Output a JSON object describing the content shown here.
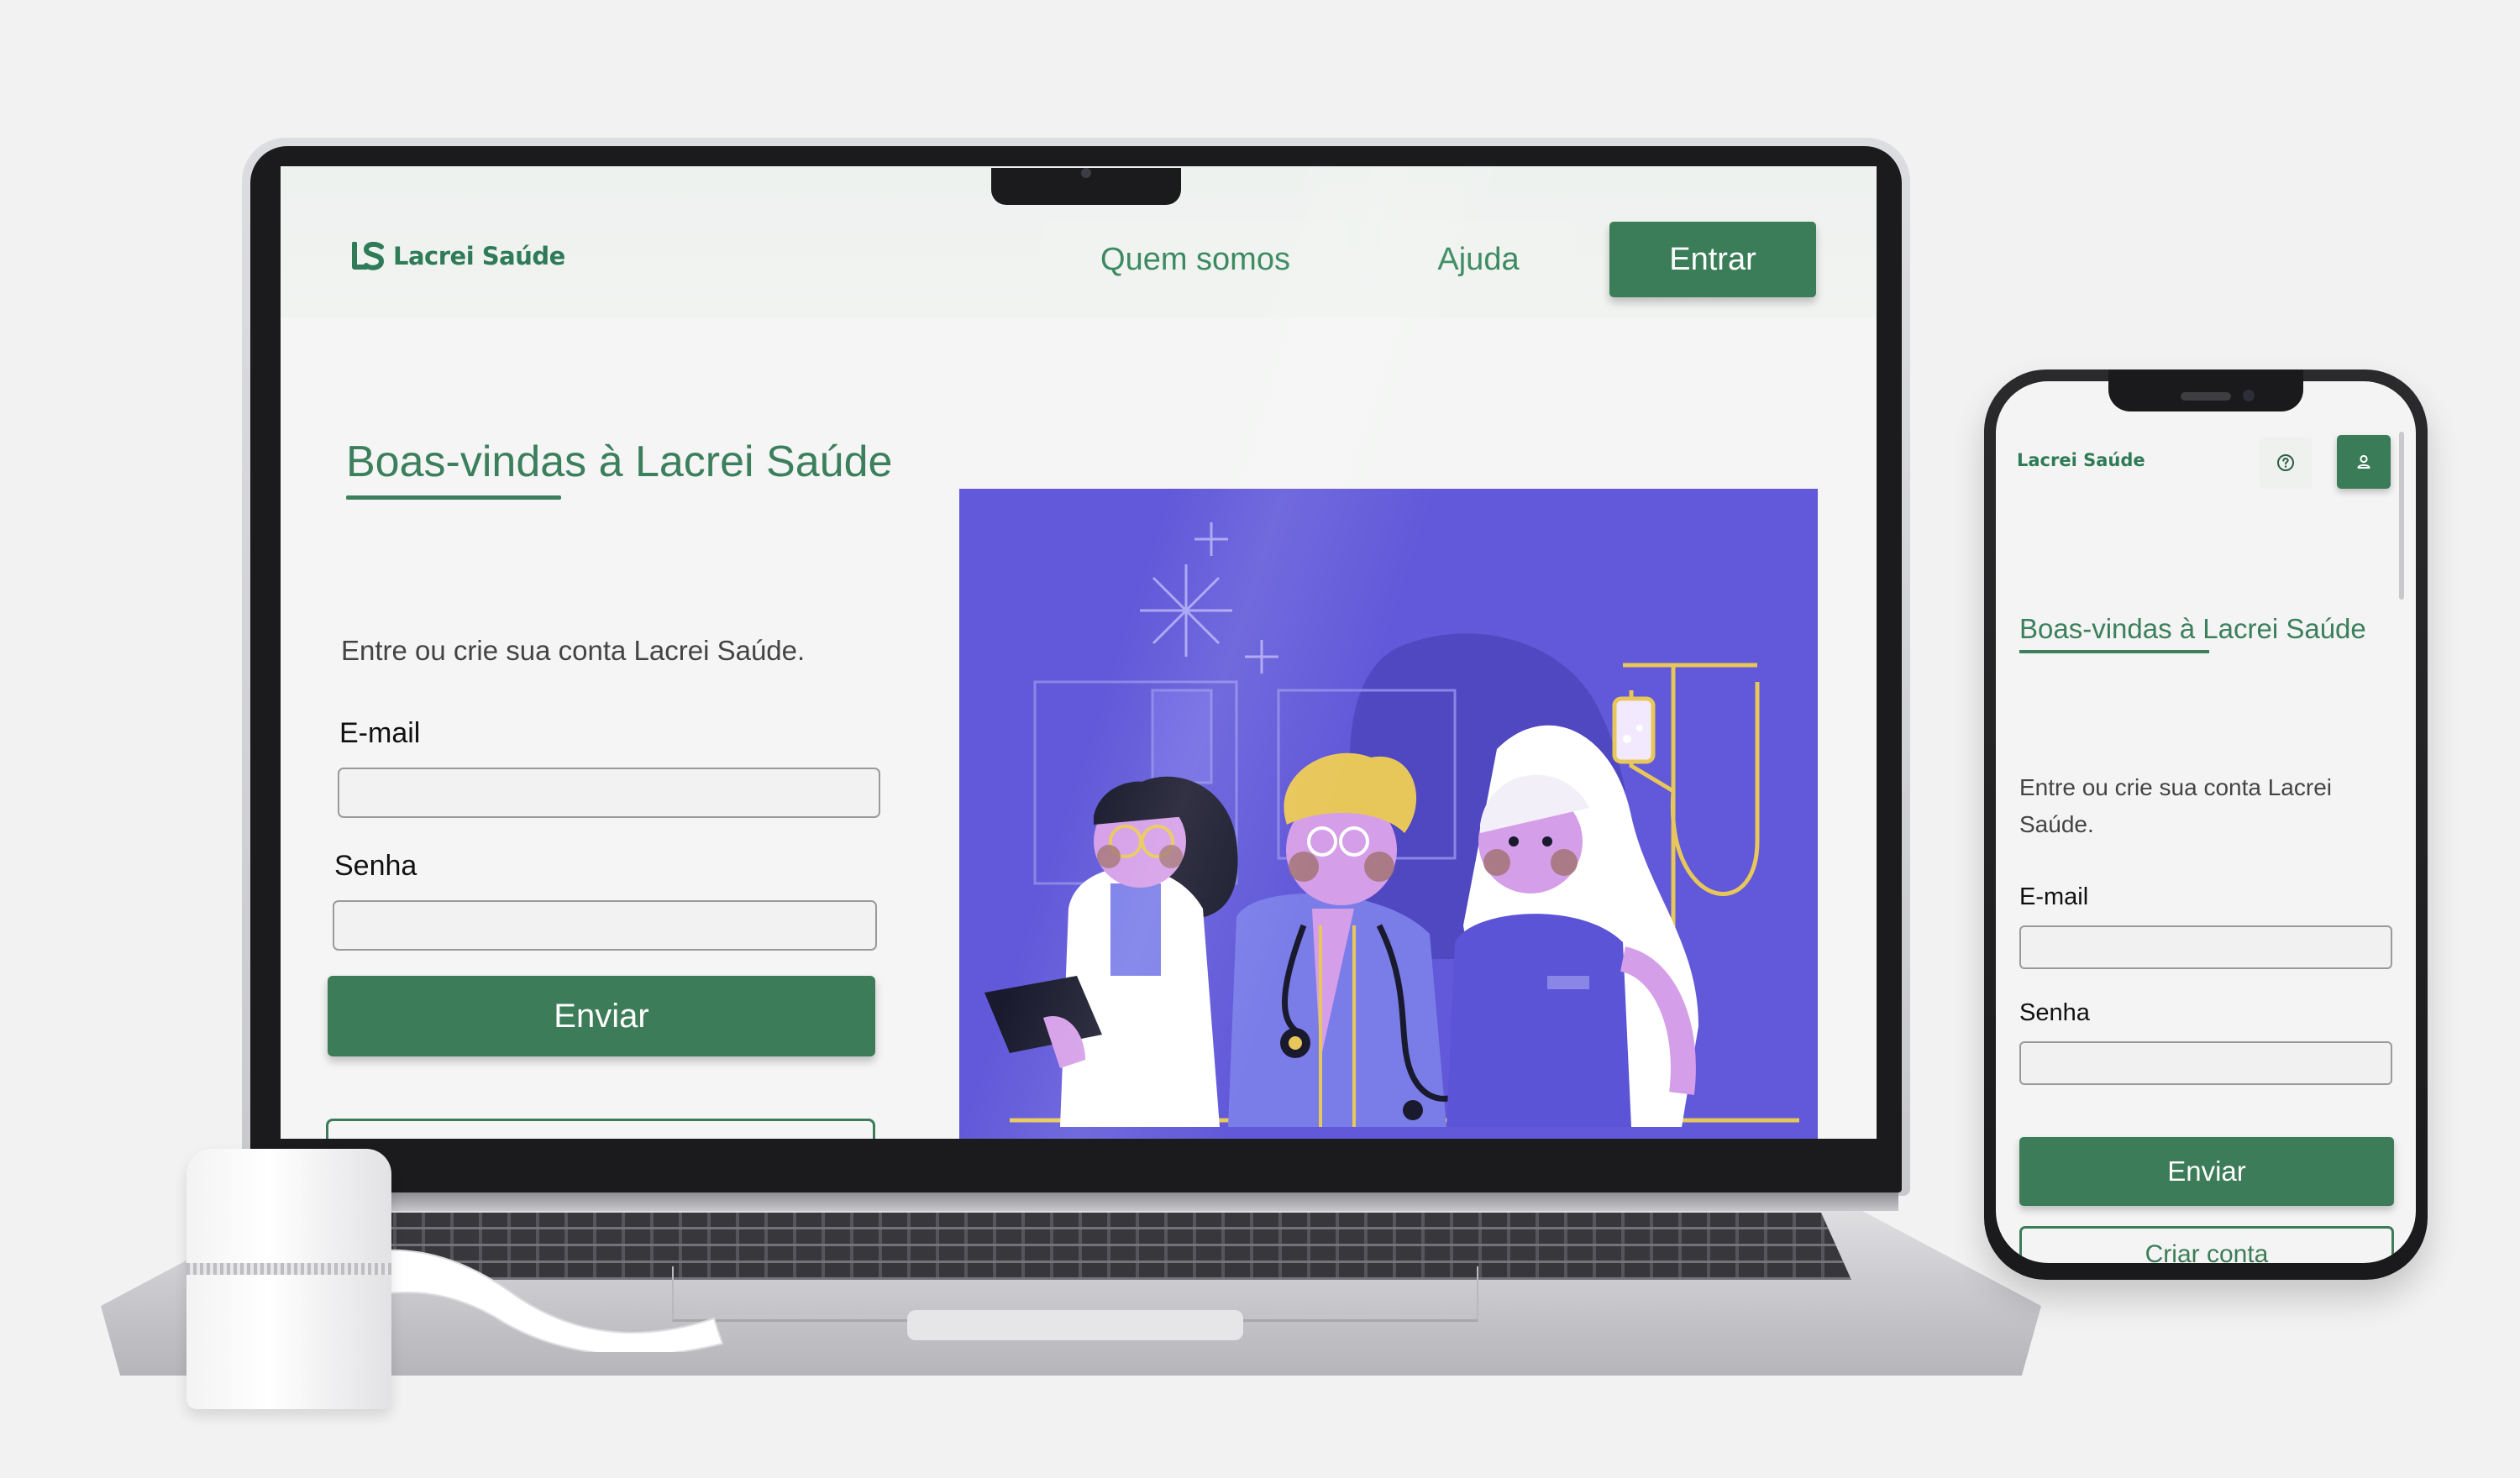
{
  "desktop": {
    "logo_text": "Lacrei Saúde",
    "nav": {
      "about_label": "Quem somos",
      "help_label": "Ajuda",
      "login_label": "Entrar"
    },
    "title": "Boas-vindas à Lacrei Saúde",
    "intro": "Entre ou crie sua conta Lacrei Saúde.",
    "email_label": "E-mail",
    "password_label": "Senha",
    "submit_label": "Enviar"
  },
  "mobile": {
    "logo_text": "Lacrei Saúde",
    "help_icon": "question-circle-icon",
    "user_icon": "user-icon",
    "title": "Boas-vindas à Lacrei Saúde",
    "intro": "Entre ou crie sua conta Lacrei Saúde.",
    "email_label": "E-mail",
    "password_label": "Senha",
    "submit_label": "Enviar",
    "secondary_label": "Criar conta"
  },
  "colors": {
    "brand_green": "#3d7c58",
    "illustration_bg": "#5b54d6",
    "page_bg": "#f4f5f4"
  }
}
